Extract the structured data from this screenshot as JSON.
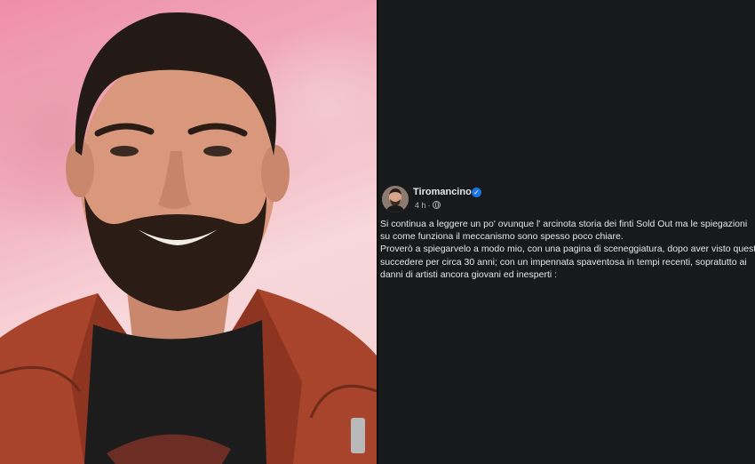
{
  "post": {
    "author": "Tiromancino",
    "time": "4 h",
    "separator": "·",
    "verified_icon": "verified-badge-icon",
    "privacy_icon": "globe-icon",
    "body_lines": [
      "Si continua a leggere un po' ovunque l' arcinota  storia dei finti Sold Out ma le spiegazioni",
      "su come funziona il meccanismo sono spesso poco chiare.",
      "Proverò a spiegarvelo a modo mio, con una pagina di sceneggiatura, dopo aver visto questo",
      "succedere per circa 30 anni; con un impennata spaventosa in tempi recenti, sopratutto ai",
      "danni di artisti ancora giovani ed inesperti :"
    ]
  },
  "colors": {
    "post_background": "#18191a",
    "text_primary": "#e4e6eb",
    "text_secondary": "#b0b3b8",
    "verified_blue": "#1b74e4"
  }
}
